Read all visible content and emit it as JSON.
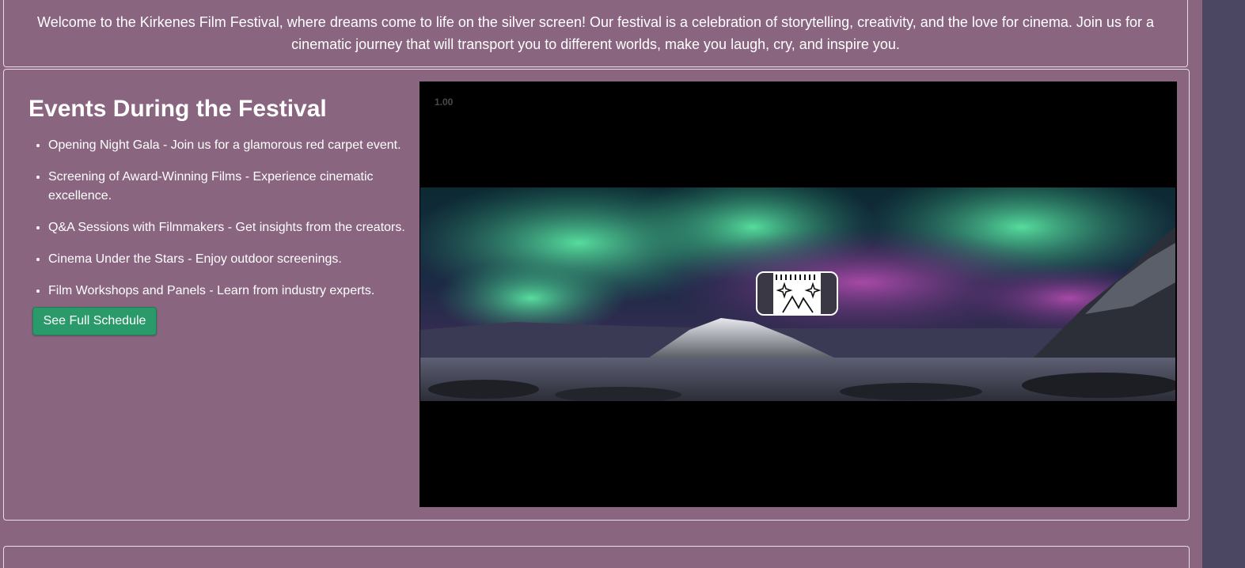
{
  "intro": {
    "text": "Welcome to the Kirkenes Film Festival, where dreams come to life on the silver screen! Our festival is a celebration of storytelling, creativity, and the love for cinema. Join us for a cinematic journey that will transport you to different worlds, make you laugh, cry, and inspire you."
  },
  "events": {
    "title": "Events During the Festival",
    "items": [
      {
        "label": "Opening Night Gala - Join us for a glamorous red carpet event."
      },
      {
        "label": "Screening of Award-Winning Films - Experience cinematic excellence."
      },
      {
        "label": "Q&A Sessions with Filmmakers - Get insights from the creators."
      },
      {
        "label": "Cinema Under the Stars - Enjoy outdoor screenings."
      },
      {
        "label": "Film Workshops and Panels - Learn from industry experts."
      }
    ],
    "button_label": "See Full Schedule"
  },
  "video": {
    "speed_label": "1.00",
    "overlay_icon": "film-strip-icon"
  },
  "colors": {
    "page_background": "#8a6580",
    "right_strip": "#4b4661",
    "button": "#2b9a6b",
    "border": "#e9dde6",
    "video_background": "#000000"
  }
}
